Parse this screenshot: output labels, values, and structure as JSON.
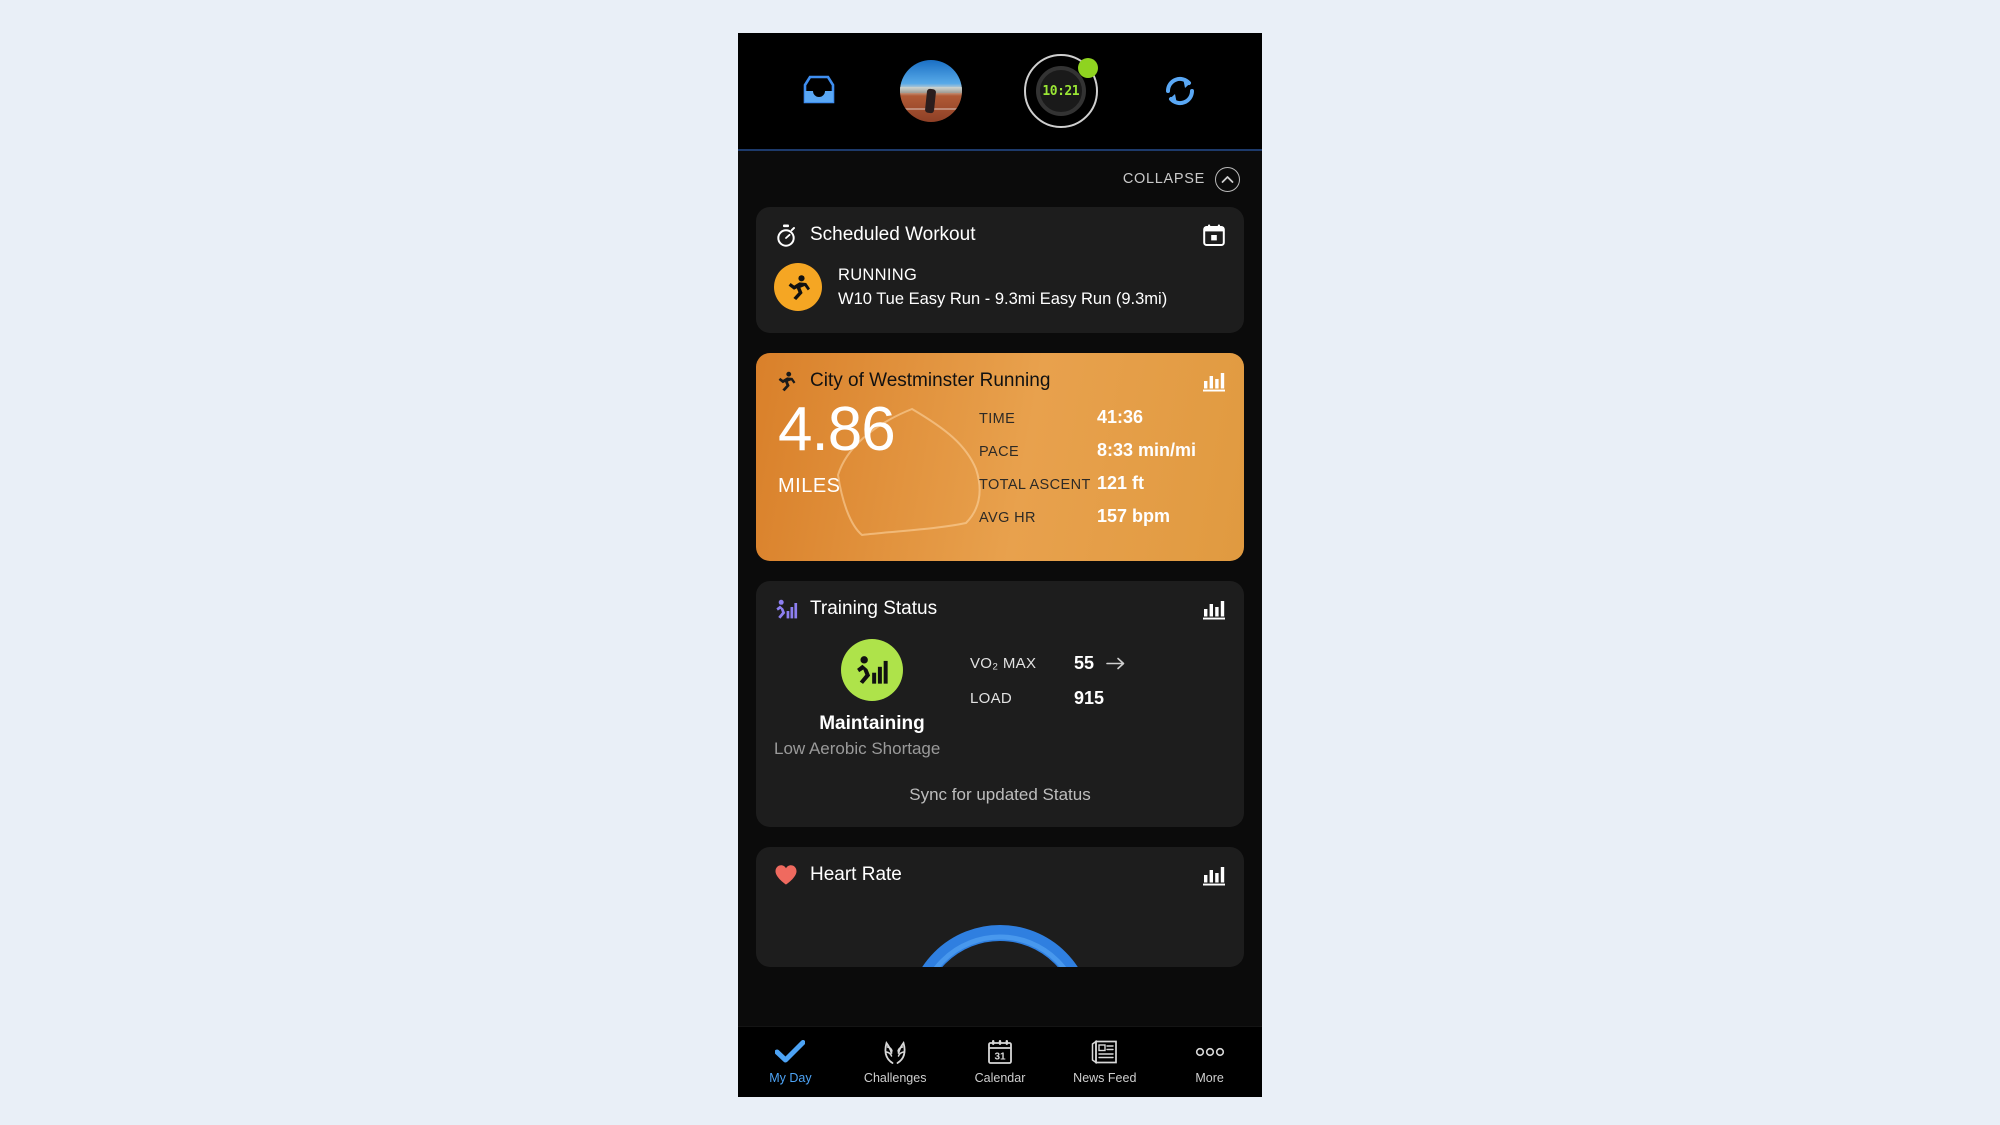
{
  "app": {
    "background_color": "#e9eff7",
    "screen_background": "#0b0b0b",
    "accent_color": "#4da3f5"
  },
  "header": {
    "inbox_icon": "inbox-icon",
    "avatar_icon": "profile-avatar",
    "device_icon": "watch-device-icon",
    "device_watch_text": "10:21",
    "device_status": "connected",
    "sync_icon": "sync-refresh-icon"
  },
  "collapse": {
    "label": "COLLAPSE",
    "icon": "chevron-up-icon"
  },
  "cards": {
    "scheduled_workout": {
      "title": "Scheduled Workout",
      "title_icon": "stopwatch-icon",
      "action_icon": "calendar-icon",
      "activity_badge_icon": "running-person-icon",
      "activity_type": "RUNNING",
      "description": "W10 Tue Easy Run - 9.3mi Easy Run (9.3mi)"
    },
    "activity": {
      "title": "City of Westminster Running",
      "title_icon": "running-person-icon",
      "action_icon": "bar-chart-icon",
      "distance": "4.86",
      "distance_unit": "MILES",
      "background_color": "#e09a40",
      "stats": [
        {
          "label": "TIME",
          "value": "41:36"
        },
        {
          "label": "PACE",
          "value": "8:33 min/mi"
        },
        {
          "label": "TOTAL ASCENT",
          "value": "121 ft"
        },
        {
          "label": "AVG HR",
          "value": "157 bpm"
        }
      ]
    },
    "training_status": {
      "title": "Training Status",
      "title_icon": "training-status-icon",
      "action_icon": "bar-chart-icon",
      "status_icon": "training-status-icon",
      "status_color": "#aee34a",
      "state": "Maintaining",
      "subtitle": "Low Aerobic Shortage",
      "metrics": [
        {
          "label": "VO₂ MAX",
          "value": "55",
          "has_arrow": true
        },
        {
          "label": "LOAD",
          "value": "915",
          "has_arrow": false
        }
      ],
      "sync_prompt": "Sync for updated Status"
    },
    "heart_rate": {
      "title": "Heart Rate",
      "title_icon": "heart-icon",
      "action_icon": "bar-chart-icon",
      "gauge_color": "#2f7fe0"
    }
  },
  "bottom_nav": {
    "items": [
      {
        "label": "My Day",
        "icon": "checkmark-icon",
        "active": true
      },
      {
        "label": "Challenges",
        "icon": "laurel-icon",
        "active": false
      },
      {
        "label": "Calendar",
        "icon": "calendar-31-icon",
        "active": false
      },
      {
        "label": "News Feed",
        "icon": "newspaper-icon",
        "active": false
      },
      {
        "label": "More",
        "icon": "ellipsis-icon",
        "active": false
      }
    ]
  }
}
